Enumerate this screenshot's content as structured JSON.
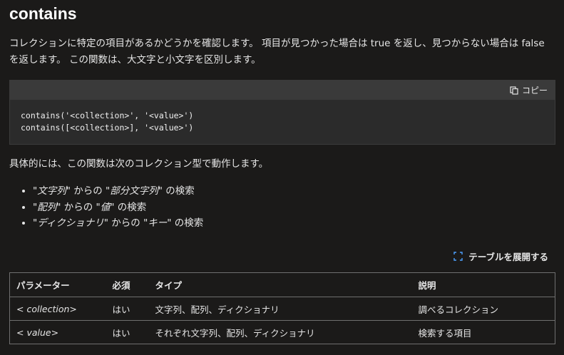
{
  "title": "contains",
  "intro": "コレクションに特定の項目があるかどうかを確認します。 項目が見つかった場合は true を返し、見つからない場合は false を返します。 この関数は、大文字と小文字を区別します。",
  "code": {
    "copy_label": "コピー",
    "lines": [
      "contains('<collection>', '<value>')",
      "contains([<collection>], '<value>')"
    ]
  },
  "para2": "具体的には、この関数は次のコレクション型で動作します。",
  "items": [
    {
      "q1": "\"",
      "a": "文字列",
      "q2": "\" からの \"",
      "b": "部分文字列",
      "q3": "\" の検索"
    },
    {
      "q1": "\"",
      "a": "配列",
      "q2": "\" からの \"",
      "b": "値",
      "q3": "\" の検索"
    },
    {
      "q1": "\"",
      "a": "ディクショナリ",
      "q2": "\" からの \"",
      "b": "キー",
      "q3": "\" の検索"
    }
  ],
  "expand_label": "テーブルを展開する",
  "table": {
    "headers": [
      "パラメーター",
      "必須",
      "タイプ",
      "説明"
    ],
    "rows": [
      [
        "< collection>",
        "はい",
        "文字列、配列、ディクショナリ",
        "調べるコレクション"
      ],
      [
        "< value>",
        "はい",
        "それぞれ文字列、配列、ディクショナリ",
        "検索する項目"
      ]
    ]
  },
  "colors": {
    "background": "#1b1a19",
    "code_bg": "#2b2b2b",
    "code_header_bg": "#3a3a3a",
    "expand_icon": "#4ea1ff"
  }
}
